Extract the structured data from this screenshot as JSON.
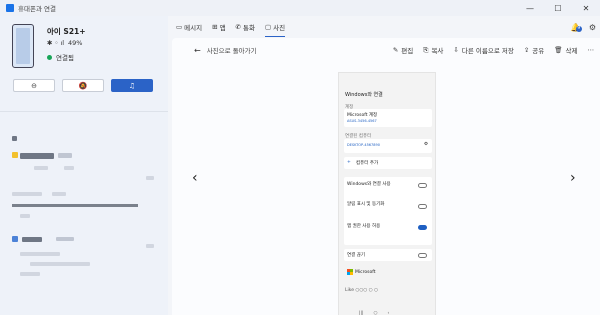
{
  "titlebar": {
    "title": "휴대폰과 연결",
    "controls": [
      "—",
      "☐",
      "✕"
    ]
  },
  "phone": {
    "name": "아이 S21+",
    "battery": "49%",
    "status_icons": "✱ ◦ ıl",
    "connection": "연결됨",
    "quick_buttons": [
      "⊖",
      "🔕",
      "♫"
    ],
    "active_button_index": 2
  },
  "nav": {
    "tabs": [
      {
        "icon": "▭",
        "label": "메시지"
      },
      {
        "icon": "⊞",
        "label": "앱"
      },
      {
        "icon": "✆",
        "label": "통화"
      },
      {
        "icon": "▢",
        "label": "사진"
      }
    ],
    "selected_tab": 3,
    "notifications_count": "9",
    "right_icons": [
      "🔔",
      "⚙"
    ]
  },
  "viewer": {
    "back_label": "사진으로 돌아가기",
    "tools": [
      {
        "icon": "✎",
        "label": "편집"
      },
      {
        "icon": "⎘",
        "label": "복사"
      },
      {
        "icon": "⇩",
        "label": "다른 이름으로 저장"
      },
      {
        "icon": "⇪",
        "label": "공유"
      },
      {
        "icon": "🗑",
        "label": "삭제"
      }
    ],
    "more": "⋯",
    "prev_arrow": "‹",
    "next_arrow": "›"
  },
  "screenshot": {
    "header": "Windows와 연결",
    "section1_label": "계정",
    "account_name": "Microsoft 계정",
    "account_email": "ASUS-3456-4567",
    "pc_label": "연결된 컴퓨터",
    "pc_name": "DESKTOP-4567890",
    "add_pc": "컴퓨터 추가",
    "option1": "Windows와 연결 사용",
    "option2": "알림 표시 및 동기화",
    "option3": "앱 권한 사용 허용",
    "option4": "연결 끊기",
    "ms_label": "Microsoft",
    "footer": "Like  ○○○  ○  ○"
  }
}
